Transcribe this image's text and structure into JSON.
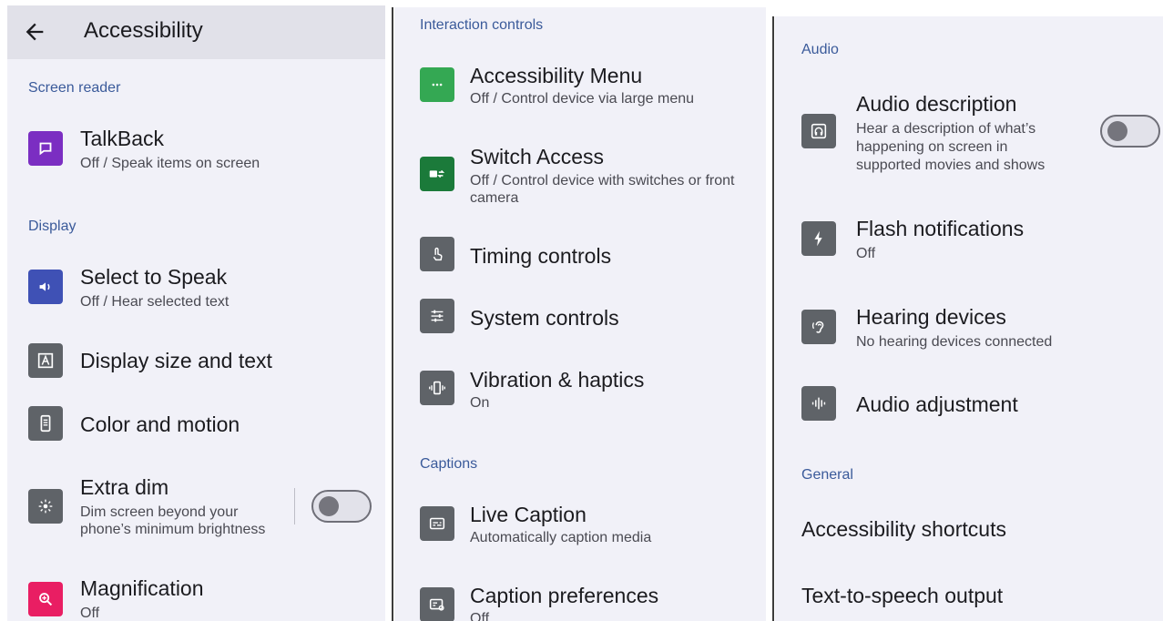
{
  "panel1": {
    "back_icon": "arrow-back-icon",
    "title": "Accessibility",
    "sections": {
      "screen_reader": "Screen reader",
      "display": "Display"
    },
    "items": [
      {
        "title": "TalkBack",
        "subtitle": "Off / Speak items on screen",
        "icon": "chat-bubble-icon",
        "color": "#7b2ec2"
      },
      {
        "title": "Select to Speak",
        "subtitle": "Off / Hear selected text",
        "icon": "speaker-icon",
        "color": "#3f51b5"
      },
      {
        "title": "Display size and text",
        "icon": "text-size-icon",
        "color": "#5f6368"
      },
      {
        "title": "Color and motion",
        "icon": "phone-color-icon",
        "color": "#5f6368"
      },
      {
        "title": "Extra dim",
        "subtitle_1": "Dim screen beyond your",
        "subtitle_2": "phone’s minimum brightness",
        "icon": "dim-icon",
        "color": "#5f6368",
        "toggle": "off"
      },
      {
        "title": "Magnification",
        "subtitle": "Off",
        "icon": "magnify-icon",
        "color": "#e91e63"
      }
    ]
  },
  "panel2": {
    "sections": {
      "interaction": "Interaction controls",
      "captions": "Captions"
    },
    "items": [
      {
        "title": "Accessibility Menu",
        "subtitle": "Off / Control device via large menu",
        "icon": "menu-dots-icon",
        "color": "#34a853"
      },
      {
        "title": "Switch Access",
        "subtitle_1": "Off / Control device with switches or front",
        "subtitle_2": "camera",
        "icon": "switch-icon",
        "color": "#1b7a3a"
      },
      {
        "title": "Timing controls",
        "icon": "touch-timer-icon",
        "color": "#5f6368"
      },
      {
        "title": "System controls",
        "icon": "sliders-icon",
        "color": "#5f6368"
      },
      {
        "title": "Vibration & haptics",
        "subtitle": "On",
        "icon": "vibration-icon",
        "color": "#5f6368"
      },
      {
        "title": "Live Caption",
        "subtitle": "Automatically caption media",
        "icon": "caption-icon",
        "color": "#5f6368"
      },
      {
        "title": "Caption preferences",
        "subtitle": "Off",
        "icon": "caption-settings-icon",
        "color": "#5f6368"
      }
    ]
  },
  "panel3": {
    "sections": {
      "audio": "Audio",
      "general": "General"
    },
    "items": [
      {
        "title": "Audio description",
        "subtitle_1": "Hear a description of what’s",
        "subtitle_2": "happening on screen in",
        "subtitle_3": "supported movies and shows",
        "icon": "audio-description-icon",
        "color": "#5f6368",
        "toggle": "off"
      },
      {
        "title": "Flash notifications",
        "subtitle": "Off",
        "icon": "flash-icon",
        "color": "#5f6368"
      },
      {
        "title": "Hearing devices",
        "subtitle": "No hearing devices connected",
        "icon": "hearing-icon",
        "color": "#5f6368"
      },
      {
        "title": "Audio adjustment",
        "icon": "audio-wave-icon",
        "color": "#5f6368"
      }
    ],
    "general_items": [
      {
        "title": "Accessibility shortcuts"
      },
      {
        "title": "Text-to-speech output"
      }
    ]
  }
}
